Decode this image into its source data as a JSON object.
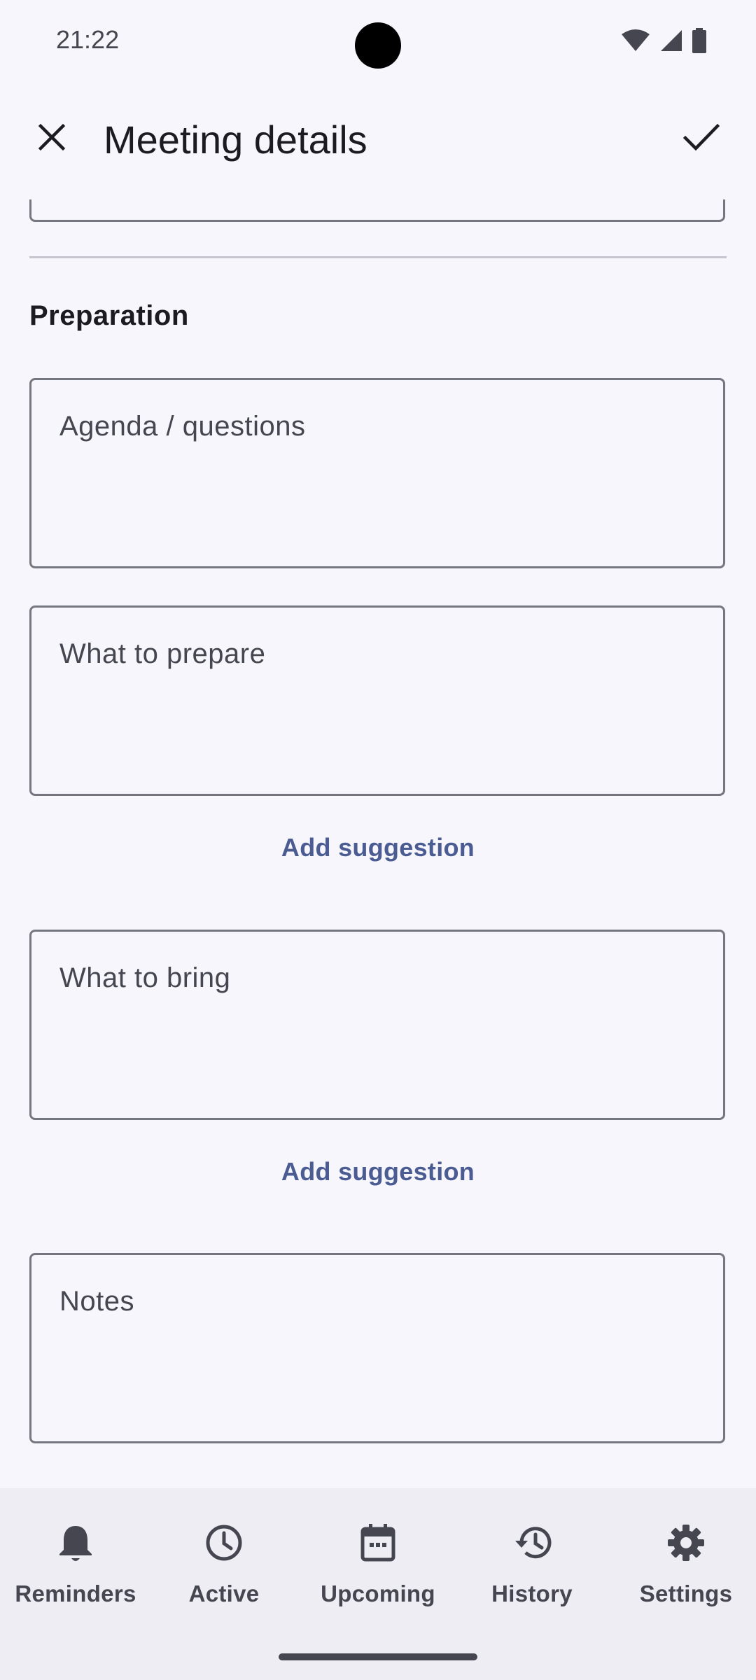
{
  "status_bar": {
    "time": "21:22",
    "icons": [
      "wifi-icon",
      "cellular-signal-icon",
      "battery-icon"
    ]
  },
  "header": {
    "title": "Meeting details",
    "close_icon": "close-icon",
    "save_icon": "check-icon"
  },
  "section": {
    "title": "Preparation"
  },
  "fields": {
    "agenda_placeholder": "Agenda / questions",
    "prepare_placeholder": "What to prepare",
    "bring_placeholder": "What to bring",
    "notes_placeholder": "Notes"
  },
  "actions": {
    "add_suggestion_1": "Add suggestion",
    "add_suggestion_2": "Add suggestion"
  },
  "bottom_nav": {
    "items": [
      {
        "label": "Reminders",
        "icon": "bell-icon"
      },
      {
        "label": "Active",
        "icon": "clock-icon"
      },
      {
        "label": "Upcoming",
        "icon": "calendar-icon"
      },
      {
        "label": "History",
        "icon": "history-icon"
      },
      {
        "label": "Settings",
        "icon": "gear-icon"
      }
    ]
  },
  "colors": {
    "background": "#f7f6fc",
    "accent": "#4a5c92",
    "outline": "#767680",
    "nav_background": "#efedf4"
  }
}
